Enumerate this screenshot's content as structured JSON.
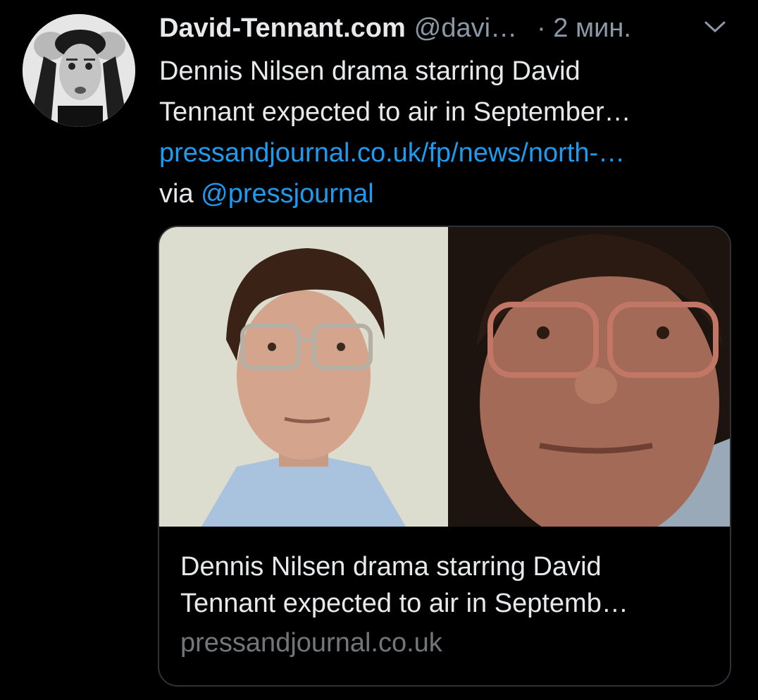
{
  "tweet": {
    "display_name": "David-Tennant.com",
    "handle": "@davi…",
    "time": "· 2 мин.",
    "text_line_1": "Dennis Nilsen drama starring David",
    "text_line_2": "Tennant expected to air in September…",
    "link": "pressandjournal.co.uk/fp/news/north-…",
    "via_label": "via",
    "via_handle": "@pressjournal"
  },
  "card": {
    "title_line_1": "Dennis Nilsen drama starring David",
    "title_line_2": "Tennant expected to air in Septemb…",
    "domain": "pressandjournal.co.uk"
  },
  "icons": {
    "menu": "chevron-down-icon"
  },
  "colors": {
    "background": "#000000",
    "text": "#e7e9ea",
    "secondary": "#8b98a5",
    "link": "#1d9bf0",
    "border": "#2f3336"
  }
}
